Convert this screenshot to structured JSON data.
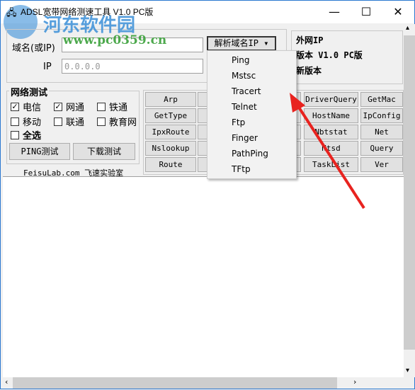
{
  "window": {
    "title": "ADSL宽带网络测速工具 V1.0 PC版",
    "watermark": "河东软件园",
    "watermark_url": "www.pc0359.cn"
  },
  "domain": {
    "label": "域名(或IP)",
    "value": "",
    "ip_label": "IP",
    "ip_value": "0.0.0.0",
    "resolve_button": "解析域名IP"
  },
  "info": {
    "line1": "外网IP",
    "line2": "版本 V1.0 PC版",
    "line3": "新版本"
  },
  "net_test": {
    "title": "网络测试",
    "options": [
      {
        "label": "电信",
        "checked": true
      },
      {
        "label": "网通",
        "checked": true
      },
      {
        "label": "铁通",
        "checked": false
      },
      {
        "label": "移动",
        "checked": false
      },
      {
        "label": "联通",
        "checked": false
      },
      {
        "label": "教育网",
        "checked": false
      }
    ],
    "select_all": "全选",
    "ping_button": "PING测试",
    "download_button": "下载测试"
  },
  "footer_text": "FeisuLab.com 飞速实验室",
  "tools": {
    "col1": [
      "Arp",
      "GetType",
      "IpxRoute",
      "Nslookup",
      "Route"
    ],
    "col4": [
      "DriverQuery",
      "HostName",
      "Nbtstat",
      "Ntsd",
      "TaskList"
    ],
    "col5": [
      "GetMac",
      "IpConfig",
      "Net",
      "Query",
      "Ver"
    ]
  },
  "menu": [
    "Ping",
    "Mstsc",
    "Tracert",
    "Telnet",
    "Ftp",
    "Finger",
    "PathPing",
    "TFtp"
  ],
  "colors": {
    "arrow": "#e8231f",
    "border": "#2b79d0"
  }
}
